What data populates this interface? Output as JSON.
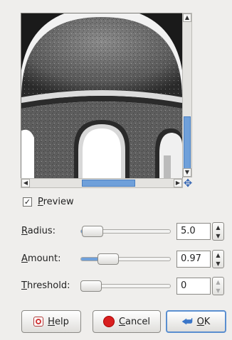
{
  "preview": {
    "checkbox_checked": true,
    "checkbox_mark": "✓",
    "label_mnemonic": "P",
    "label_rest": "review"
  },
  "scrollbars": {
    "up_arrow": "▲",
    "down_arrow": "▼",
    "left_arrow": "◀",
    "right_arrow": "▶",
    "navigate_icon": "✥"
  },
  "params": {
    "radius": {
      "mnemonic": "R",
      "rest": "adius:",
      "value": "5.0",
      "level": 0.02
    },
    "amount": {
      "mnemonic": "A",
      "rest": "mount:",
      "value": "0.97",
      "level": 0.25
    },
    "threshold": {
      "mnemonic": "T",
      "rest": "hreshold:",
      "value": "0",
      "level": 0.0
    }
  },
  "spin": {
    "up": "▲",
    "down": "▼"
  },
  "buttons": {
    "help": {
      "mnemonic": "H",
      "rest": "elp"
    },
    "cancel": {
      "mnemonic": "C",
      "rest": "ancel"
    },
    "ok": {
      "mnemonic": "O",
      "rest": "K",
      "icon": "⮨"
    }
  },
  "colors": {
    "accent": "#6fa0da",
    "cancel_red": "#d81f1f",
    "background": "#efeeec"
  }
}
